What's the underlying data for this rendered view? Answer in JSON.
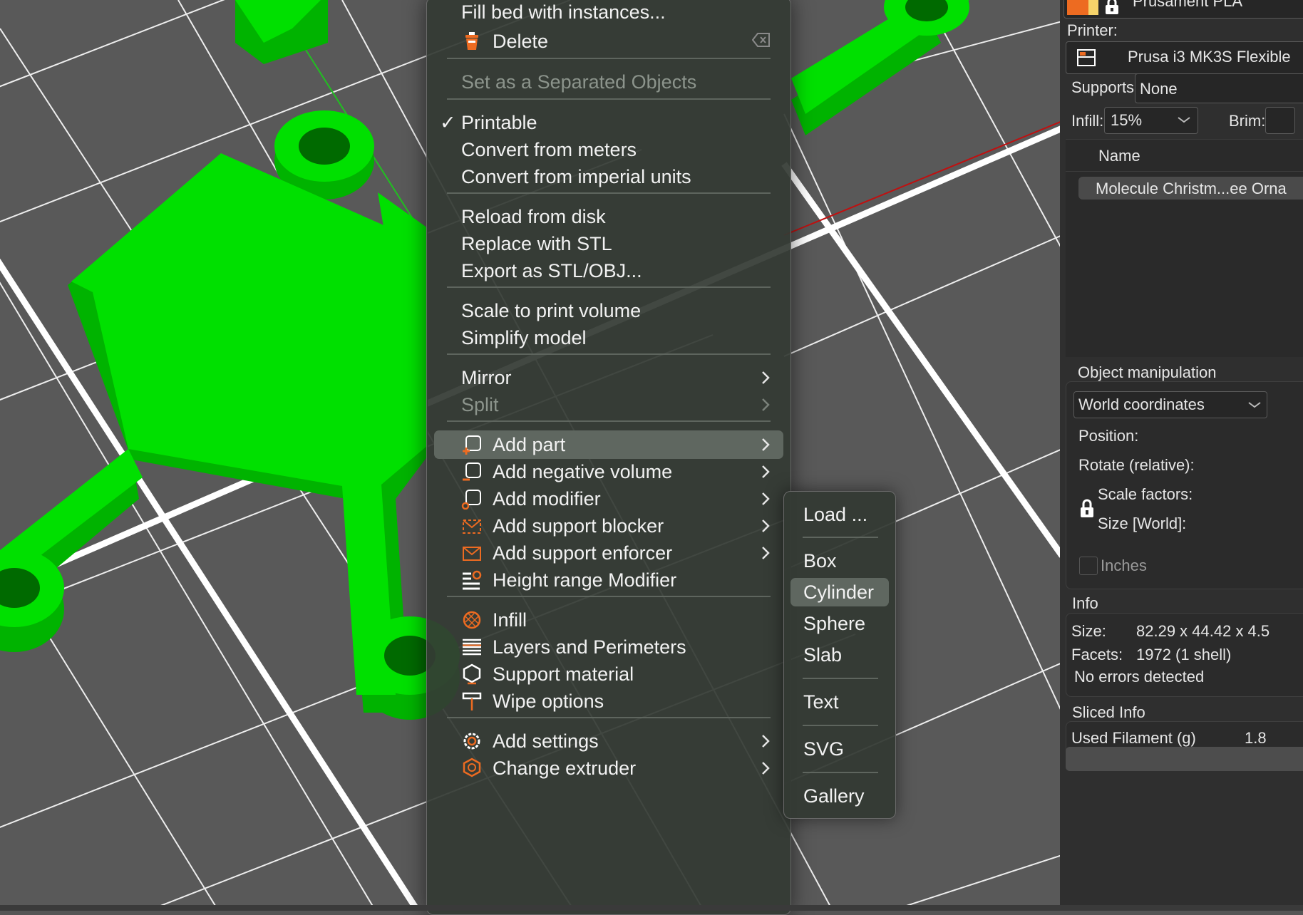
{
  "context_menu": {
    "fill_bed": "Fill bed with instances...",
    "delete": "Delete",
    "set_separated": "Set as a Separated Objects",
    "printable": "Printable",
    "printable_check": "✓",
    "convert_meters": "Convert from meters",
    "convert_imperial": "Convert from imperial units",
    "reload_disk": "Reload from disk",
    "replace_stl": "Replace with STL",
    "export_stl": "Export as STL/OBJ...",
    "scale_volume": "Scale to print volume",
    "simplify": "Simplify model",
    "mirror": "Mirror",
    "split": "Split",
    "add_part": "Add part",
    "add_negative": "Add negative volume",
    "add_modifier": "Add modifier",
    "add_support_blocker": "Add support blocker",
    "add_support_enforcer": "Add support enforcer",
    "height_range": "Height range Modifier",
    "infill": "Infill",
    "layers_perimeters": "Layers and Perimeters",
    "support_material": "Support material",
    "wipe_options": "Wipe options",
    "add_settings": "Add settings",
    "change_extruder": "Change extruder"
  },
  "submenu": {
    "load": "Load ...",
    "box": "Box",
    "cylinder": "Cylinder",
    "sphere": "Sphere",
    "slab": "Slab",
    "text": "Text",
    "svg": "SVG",
    "gallery": "Gallery"
  },
  "panel": {
    "filament": "Prusament PLA",
    "printer_label": "Printer:",
    "printer_value": "Prusa i3 MK3S Flexible",
    "supports_label": "Supports:",
    "supports_value": "None",
    "infill_label": "Infill:",
    "infill_value": "15%",
    "brim_label": "Brim:",
    "name_header": "Name",
    "object_name": "Molecule Christm...ee Orna",
    "obj_manip_title": "Object manipulation",
    "coord_select": "World coordinates",
    "position_label": "Position:",
    "rotate_label": "Rotate (relative):",
    "scale_label": "Scale factors:",
    "size_label": "Size [World]:",
    "inches_label": "Inches",
    "info_title": "Info",
    "size_info_label": "Size:",
    "size_info_value": "82.29 x 44.42 x 4.5",
    "facets_label": "Facets:",
    "facets_value": "1972 (1 shell)",
    "errors_text": "No errors detected",
    "sliced_info_title": "Sliced Info",
    "used_filament_label": "Used Filament (g)",
    "used_filament_value": "1.8"
  },
  "colors": {
    "model_green": "#00d400",
    "accent_orange": "#ed6b21",
    "menu_bg": "#343a34"
  }
}
